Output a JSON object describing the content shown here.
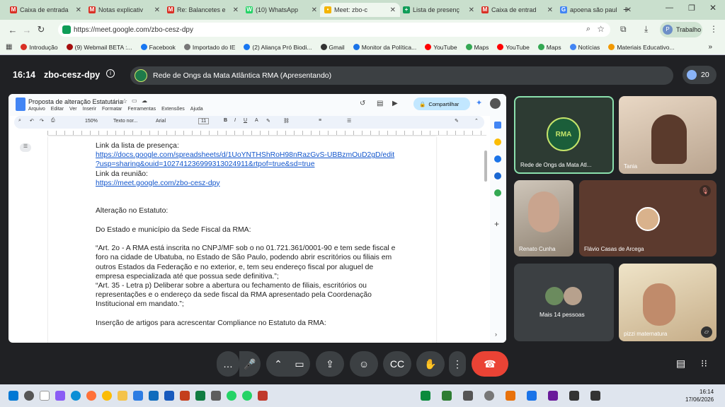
{
  "tabs": [
    {
      "label": "Caixa de entrada",
      "color": "#d93025",
      "glyph": "M"
    },
    {
      "label": "Notas explicativ",
      "color": "#d93025",
      "glyph": "M"
    },
    {
      "label": "Re: Balancetes e",
      "color": "#d93025",
      "glyph": "M"
    },
    {
      "label": "(10) WhatsApp",
      "color": "#25d366",
      "glyph": "W"
    },
    {
      "label": "Meet: zbo-c",
      "color": "#f4b400",
      "glyph": "•"
    },
    {
      "label": "Lista de presenç",
      "color": "#0f9d58",
      "glyph": "+"
    },
    {
      "label": "Caixa de entrad",
      "color": "#d93025",
      "glyph": "M"
    },
    {
      "label": "apoena são paul",
      "color": "#4285f4",
      "glyph": "G"
    }
  ],
  "browser": {
    "url": "https://meet.google.com/zbo-cesz-dpy",
    "profile_label": "Trabalho",
    "profile_initial": "P"
  },
  "bookmarks": [
    {
      "label": "Introdução",
      "color": "#d93025"
    },
    {
      "label": "(9) Webmail BETA :...",
      "color": "#a50e0e"
    },
    {
      "label": "Facebook",
      "color": "#1877f2"
    },
    {
      "label": "Importado do IE",
      "color": "#777"
    },
    {
      "label": "(2) Aliança Pró Biodi...",
      "color": "#1877f2"
    },
    {
      "label": "Gmail",
      "color": "#333"
    },
    {
      "label": "Monitor da Política...",
      "color": "#1a73e8"
    },
    {
      "label": "YouTube",
      "color": "#ff0000"
    },
    {
      "label": "Maps",
      "color": "#34a853"
    },
    {
      "label": "YouTube",
      "color": "#ff0000"
    },
    {
      "label": "Maps",
      "color": "#34a853"
    },
    {
      "label": "Notícias",
      "color": "#4285f4"
    },
    {
      "label": "Materiais Educativo...",
      "color": "#f29900"
    }
  ],
  "meet": {
    "time": "16:14",
    "code": "zbo-cesz-dpy",
    "presenter": "Rede de Ongs da Mata Atlântica RMA (Apresentando)",
    "participant_count": "20"
  },
  "doc": {
    "title": "Proposta de alteração Estatutária",
    "menu": [
      "Arquivo",
      "Editar",
      "Ver",
      "Inserir",
      "Formatar",
      "Ferramentas",
      "Extensões",
      "Ajuda"
    ],
    "share_label": "Compartilhar",
    "zoom": "150%",
    "style": "Texto nor...",
    "font": "Arial",
    "size": "11",
    "lines": [
      {
        "text": "Link da lista de presença:",
        "link": false
      },
      {
        "text": "https://docs.google.com/spreadsheets/d/1UoYNTHShRoH98nRazGvS-UBBzmOuD2gD/edit",
        "link": true
      },
      {
        "text": "?usp=sharing&ouid=102741236999313024911&rtpof=true&sd=true",
        "link": true
      },
      {
        "text": "Link da reunião:",
        "link": false
      },
      {
        "text": "https://meet.google.com/zbo-cesz-dpy",
        "link": true
      },
      {
        "text": "",
        "link": false
      },
      {
        "text": "",
        "link": false
      },
      {
        "text": "Alteração no Estatuto:",
        "link": false
      },
      {
        "text": "",
        "link": false
      },
      {
        "text": "Do Estado e município da Sede Fiscal da RMA:",
        "link": false
      },
      {
        "text": "",
        "link": false
      },
      {
        "text": "“Art. 2o - A RMA está inscrita no CNPJ/MF sob o no 01.721.361/0001-90 e tem sede fiscal e",
        "link": false
      },
      {
        "text": "foro na cidade de Ubatuba, no Estado de São Paulo, podendo abrir escritórios ou filiais em",
        "link": false
      },
      {
        "text": "outros Estados da Federação e no exterior, e, tem seu endereço fiscal por aluguel de",
        "link": false
      },
      {
        "text": "empresa especializada até que possua sede definitiva.”;",
        "link": false
      },
      {
        "text": "“Art. 35 - Letra p) Deliberar sobre a abertura ou fechamento de filiais, escritórios ou",
        "link": false
      },
      {
        "text": "representações e o endereço da sede fiscal da RMA apresentado pela Coordenação",
        "link": false
      },
      {
        "text": "Institucional em mandato.”;",
        "link": false
      },
      {
        "text": "",
        "link": false
      },
      {
        "text": "Inserção de artigos para acrescentar Compliance no Estatuto da RMA:",
        "link": false
      }
    ]
  },
  "participants": [
    {
      "name": "Rede de Ongs da Mata Atl...",
      "logo": "RMA"
    },
    {
      "name": "Tania"
    },
    {
      "name": "Renato Cunha"
    },
    {
      "name": "Flávio Casas de Arcega"
    },
    {
      "name": "Mais 14 pessoas"
    },
    {
      "name": "pizzi maternatura"
    }
  ],
  "taskbar": {
    "time": "16:14",
    "date": "17/06/2026"
  }
}
